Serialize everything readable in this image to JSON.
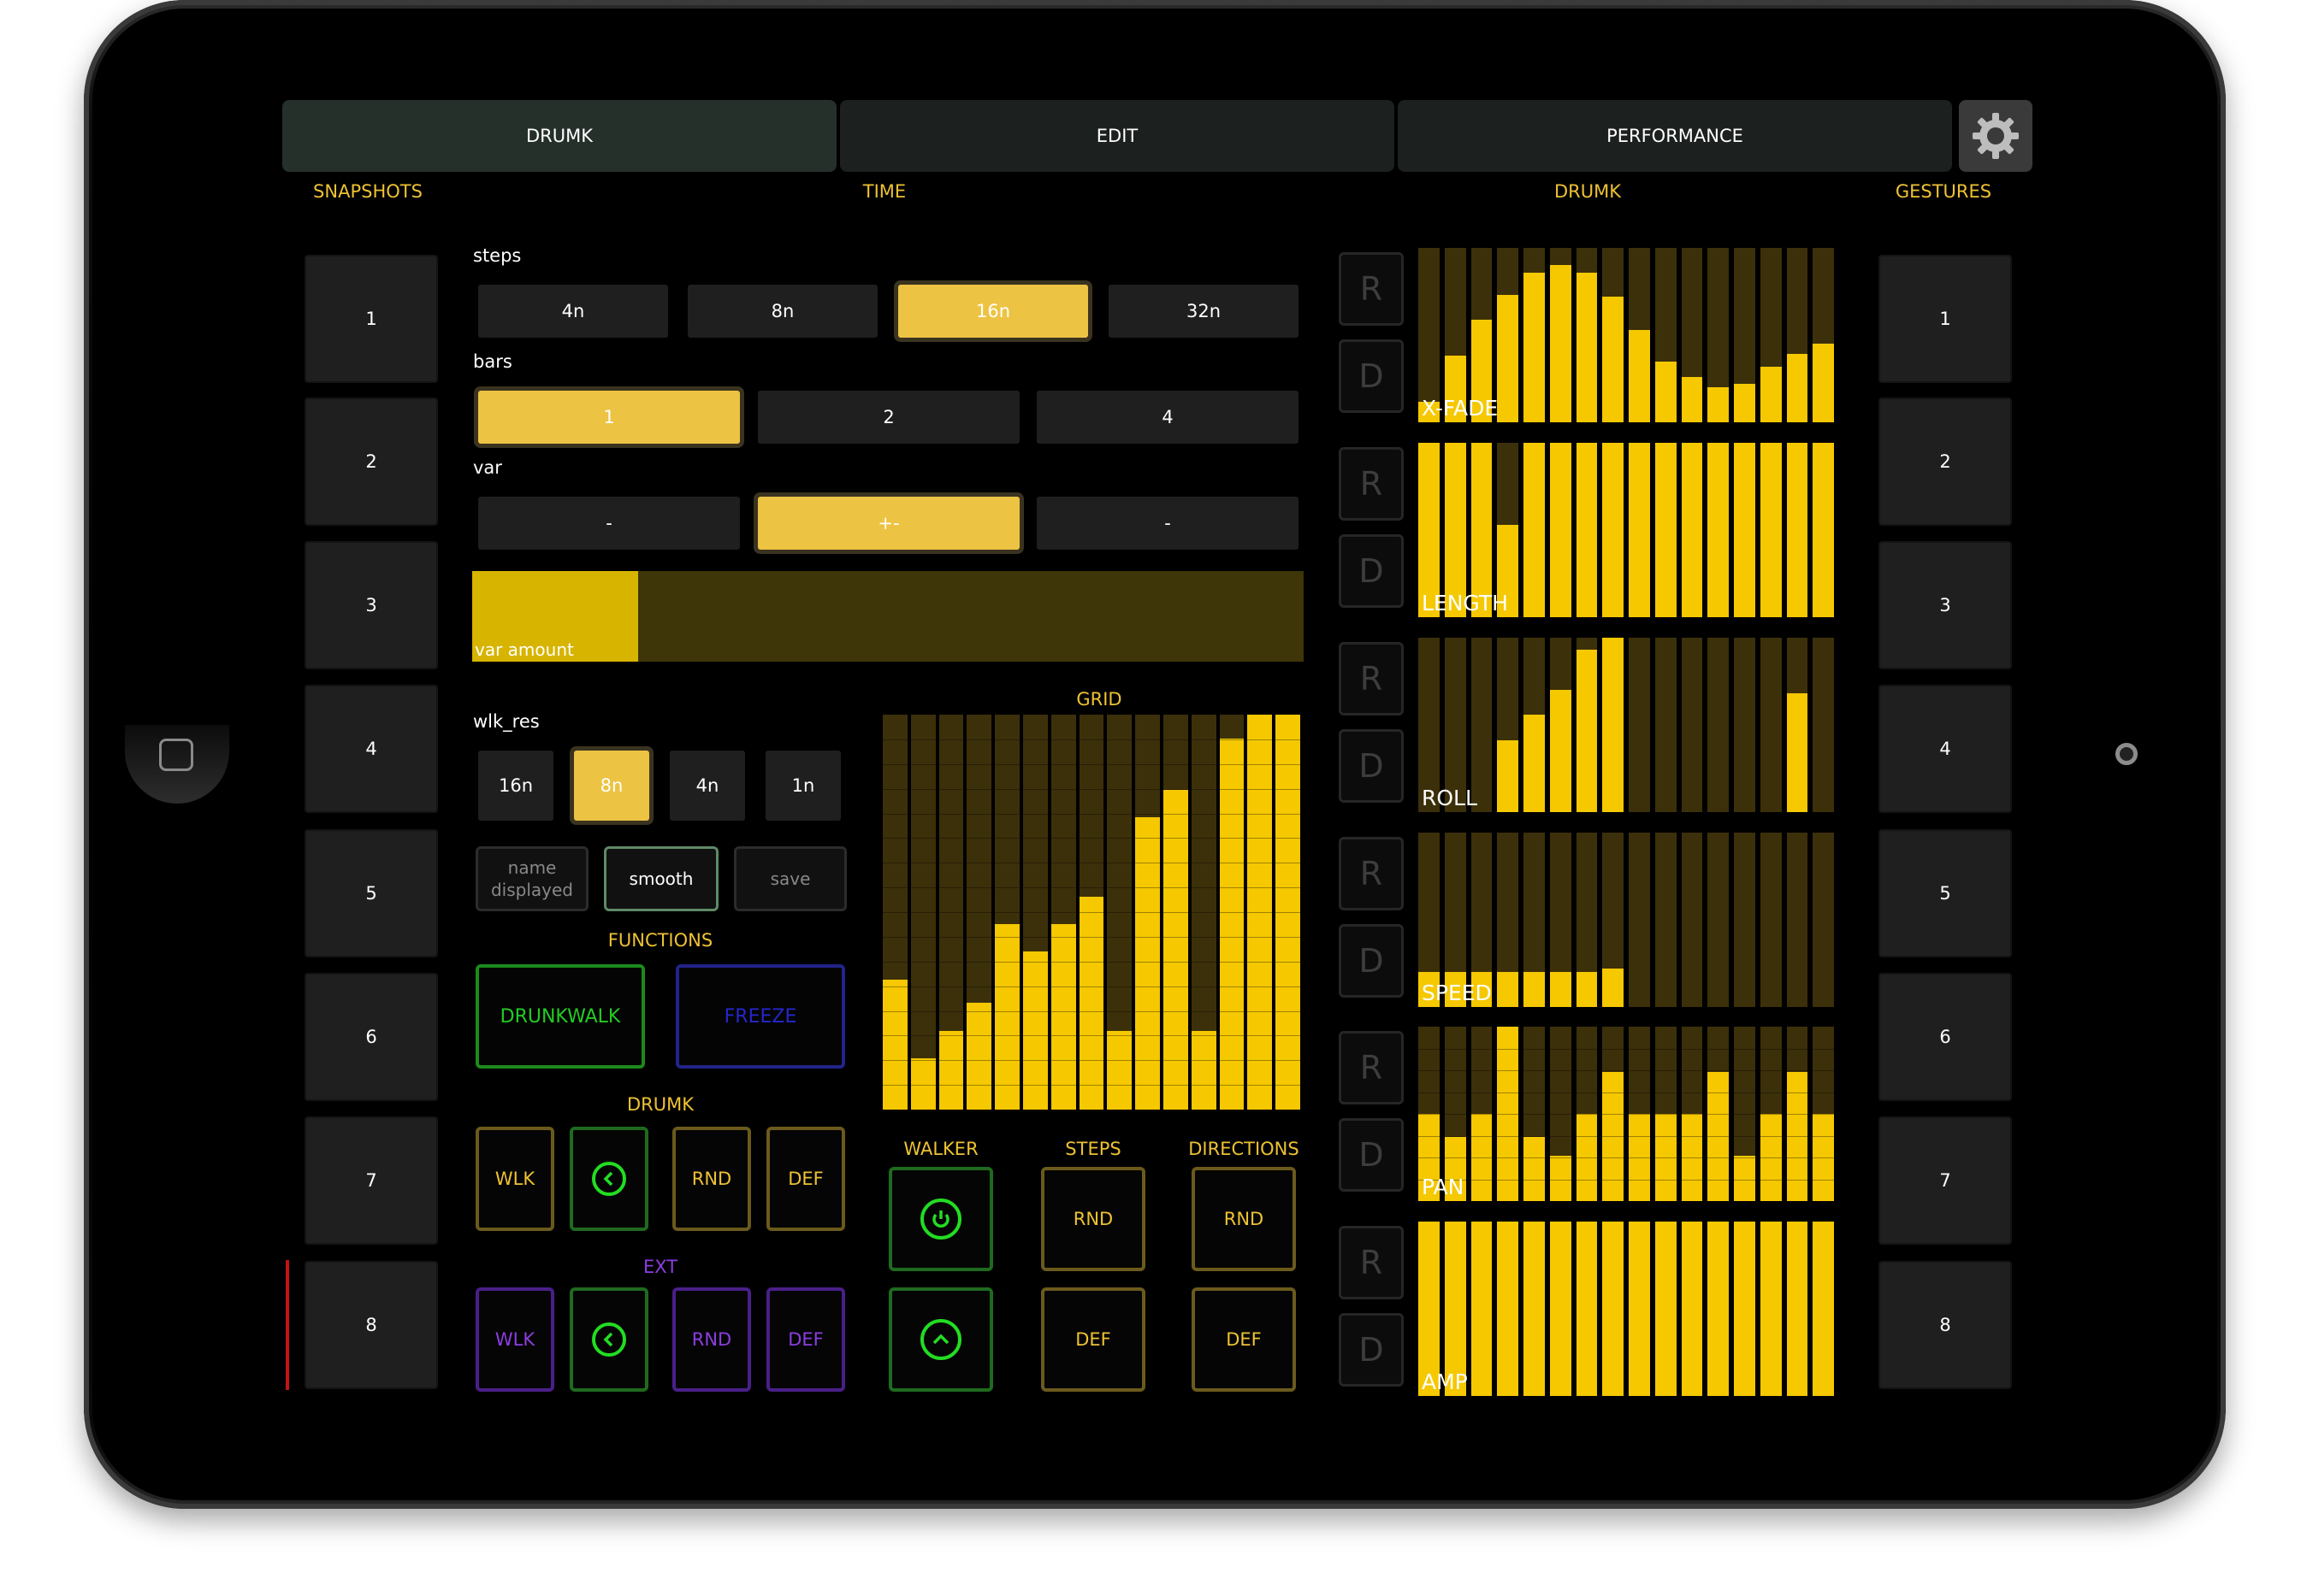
{
  "tabs": [
    {
      "label": "DRUMK",
      "active": true
    },
    {
      "label": "EDIT",
      "active": false
    },
    {
      "label": "PERFORMANCE",
      "active": false
    }
  ],
  "settings_icon": "gear-icon",
  "sections": {
    "snapshots": "SNAPSHOTS",
    "time": "TIME",
    "drumk": "DRUMK",
    "gestures": "GESTURES"
  },
  "snapshots": [
    "1",
    "2",
    "3",
    "4",
    "5",
    "6",
    "7",
    "8"
  ],
  "gestures": [
    "1",
    "2",
    "3",
    "4",
    "5",
    "6",
    "7",
    "8"
  ],
  "time": {
    "steps_label": "steps",
    "steps": [
      {
        "label": "4n",
        "on": false
      },
      {
        "label": "8n",
        "on": false
      },
      {
        "label": "16n",
        "on": true
      },
      {
        "label": "32n",
        "on": false
      }
    ],
    "bars_label": "bars",
    "bars": [
      {
        "label": "1",
        "on": true
      },
      {
        "label": "2",
        "on": false
      },
      {
        "label": "4",
        "on": false
      }
    ],
    "var_label": "var",
    "var": [
      {
        "label": "-",
        "on": false
      },
      {
        "label": "+-",
        "on": true
      },
      {
        "label": "-",
        "on": false
      }
    ],
    "var_amount_label": "var amount",
    "var_amount": 0.2,
    "wlk_res_label": "wlk_res",
    "wlk_res": [
      {
        "label": "16n",
        "on": false
      },
      {
        "label": "8n",
        "on": true
      },
      {
        "label": "4n",
        "on": false
      },
      {
        "label": "1n",
        "on": false
      }
    ],
    "name_displayed": "name displayed",
    "smooth": "smooth",
    "save": "save"
  },
  "functions": {
    "title": "FUNCTIONS",
    "drunkwalk": "DRUNKWALK",
    "freeze": "FREEZE"
  },
  "drumk_group": {
    "title": "DRUMK",
    "buttons": [
      "WLK",
      "RND",
      "DEF"
    ],
    "back_icon": "chevron-left-icon"
  },
  "ext_group": {
    "title": "EXT",
    "buttons": [
      "WLK",
      "RND",
      "DEF"
    ],
    "back_icon": "chevron-left-icon"
  },
  "grid": {
    "title": "GRID",
    "values": [
      0.33,
      0.13,
      0.2,
      0.27,
      0.47,
      0.4,
      0.47,
      0.54,
      0.2,
      0.74,
      0.81,
      0.2,
      0.94,
      1.0,
      1.0
    ]
  },
  "walker": {
    "title": "WALKER",
    "power_icon": "power-icon",
    "up_icon": "chevron-up-icon"
  },
  "steps_group": {
    "title": "STEPS",
    "rnd": "RND",
    "def": "DEF"
  },
  "directions_group": {
    "title": "DIRECTIONS",
    "rnd": "RND",
    "def": "DEF"
  },
  "multisliders": [
    {
      "label": "X-FADE",
      "r": "R",
      "d": "D",
      "values": [
        0.12,
        0.38,
        0.59,
        0.73,
        0.86,
        0.9,
        0.86,
        0.72,
        0.53,
        0.35,
        0.26,
        0.2,
        0.22,
        0.32,
        0.39,
        0.45
      ]
    },
    {
      "label": "LENGTH",
      "r": "R",
      "d": "D",
      "values": [
        1.0,
        1.0,
        1.0,
        0.53,
        1.0,
        1.0,
        1.0,
        1.0,
        1.0,
        1.0,
        1.0,
        1.0,
        1.0,
        1.0,
        1.0,
        1.0
      ]
    },
    {
      "label": "ROLL",
      "r": "R",
      "d": "D",
      "values": [
        0,
        0,
        0,
        0.41,
        0.56,
        0.7,
        0.93,
        1.0,
        0,
        0,
        0,
        0,
        0,
        0,
        0.68,
        0
      ]
    },
    {
      "label": "SPEED",
      "r": "R",
      "d": "D",
      "values": [
        0.2,
        0.2,
        0.2,
        0.2,
        0.2,
        0.2,
        0.2,
        0.22,
        0,
        0,
        0,
        0,
        0,
        0,
        0,
        0
      ]
    },
    {
      "label": "PAN",
      "r": "R",
      "d": "D",
      "values": [
        0.5,
        0.37,
        0.5,
        1.0,
        0.37,
        0.26,
        0.5,
        0.74,
        0.5,
        0.5,
        0.5,
        0.74,
        0.26,
        0.5,
        0.74,
        0.5
      ]
    },
    {
      "label": "AMP",
      "r": "R",
      "d": "D",
      "values": [
        1,
        1,
        1,
        1,
        1,
        1,
        1,
        1,
        1,
        1,
        1,
        1,
        1,
        1,
        1,
        1
      ]
    }
  ],
  "colors": {
    "accent": "#eec233",
    "bar_on": "#f5c800",
    "bar_off": "#3c300a",
    "green": "#22dd22",
    "purple": "#8c3ee0",
    "blue": "#2222cc"
  }
}
